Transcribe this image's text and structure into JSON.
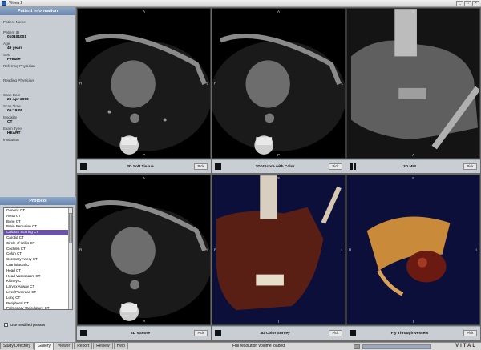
{
  "window": {
    "title": "Vitrea 2"
  },
  "patient_panel": {
    "header": "Patient Information",
    "fields": [
      {
        "label": "Patient Name",
        "value": ""
      },
      {
        "label": "Patient ID",
        "value": "010101001"
      },
      {
        "label": "Age",
        "value": "49 years"
      },
      {
        "label": "Sex",
        "value": "Female"
      },
      {
        "label": "Referring Physician",
        "value": ""
      },
      {
        "label": "Reading Physician",
        "value": ""
      },
      {
        "label": "Scan Date",
        "value": "26 Apr 2000"
      },
      {
        "label": "Scan Time",
        "value": "05:19:05"
      },
      {
        "label": "Modality",
        "value": "CT"
      },
      {
        "label": "Exam Type",
        "value": "HEART"
      },
      {
        "label": "Institution",
        "value": ""
      }
    ]
  },
  "protocol": {
    "header": "Protocol",
    "items": [
      "Generic CT",
      "Aorta CT",
      "Bone CT",
      "Brain Perfusion CT",
      "Calcium Scoring CT",
      "Carotid CT",
      "Circle of Willis CT",
      "Cochlea CT",
      "Colon CT",
      "Coronary Artery CT",
      "Craniofacial CT",
      "Head CT",
      "Head Vasospasm CT",
      "Kidney CT",
      "Larynx Airway CT",
      "Liver/Pancreas CT",
      "Lung CT",
      "Peripheral CT",
      "Pulmonary Vasculature CT"
    ],
    "selected_index": 4,
    "checkbox_label": "Use modified presets",
    "checkbox_checked": true
  },
  "viewports": [
    {
      "title": "2D Soft Tissue",
      "top": "A",
      "bottom": "P",
      "left": "R",
      "right": "L",
      "pick": "Pick"
    },
    {
      "title": "2D VScore with Color",
      "top": "A",
      "bottom": "P",
      "left": "R",
      "right": "L",
      "pick": "Pick"
    },
    {
      "title": "3D MIP",
      "top": "S",
      "bottom": "A",
      "left": "",
      "right": "",
      "pick": "Pick"
    },
    {
      "title": "2D VScore",
      "top": "A",
      "bottom": "P",
      "left": "R",
      "right": "L",
      "pick": "Pick"
    },
    {
      "title": "3D Color Survey",
      "top": "S",
      "bottom": "I",
      "left": "R",
      "right": "L",
      "pick": "Pick"
    },
    {
      "title": "Fly Through Vessels",
      "top": "S",
      "bottom": "I",
      "left": "R",
      "right": "L",
      "pick": "Pick"
    }
  ],
  "bottom_tabs": [
    "Study Directory",
    "Gallery",
    "Viewer",
    "Report",
    "Review",
    "Help"
  ],
  "active_tab": 1,
  "status": {
    "message": "Full resolution volume loaded.",
    "progress": 1.0,
    "brand": "VITAL"
  }
}
